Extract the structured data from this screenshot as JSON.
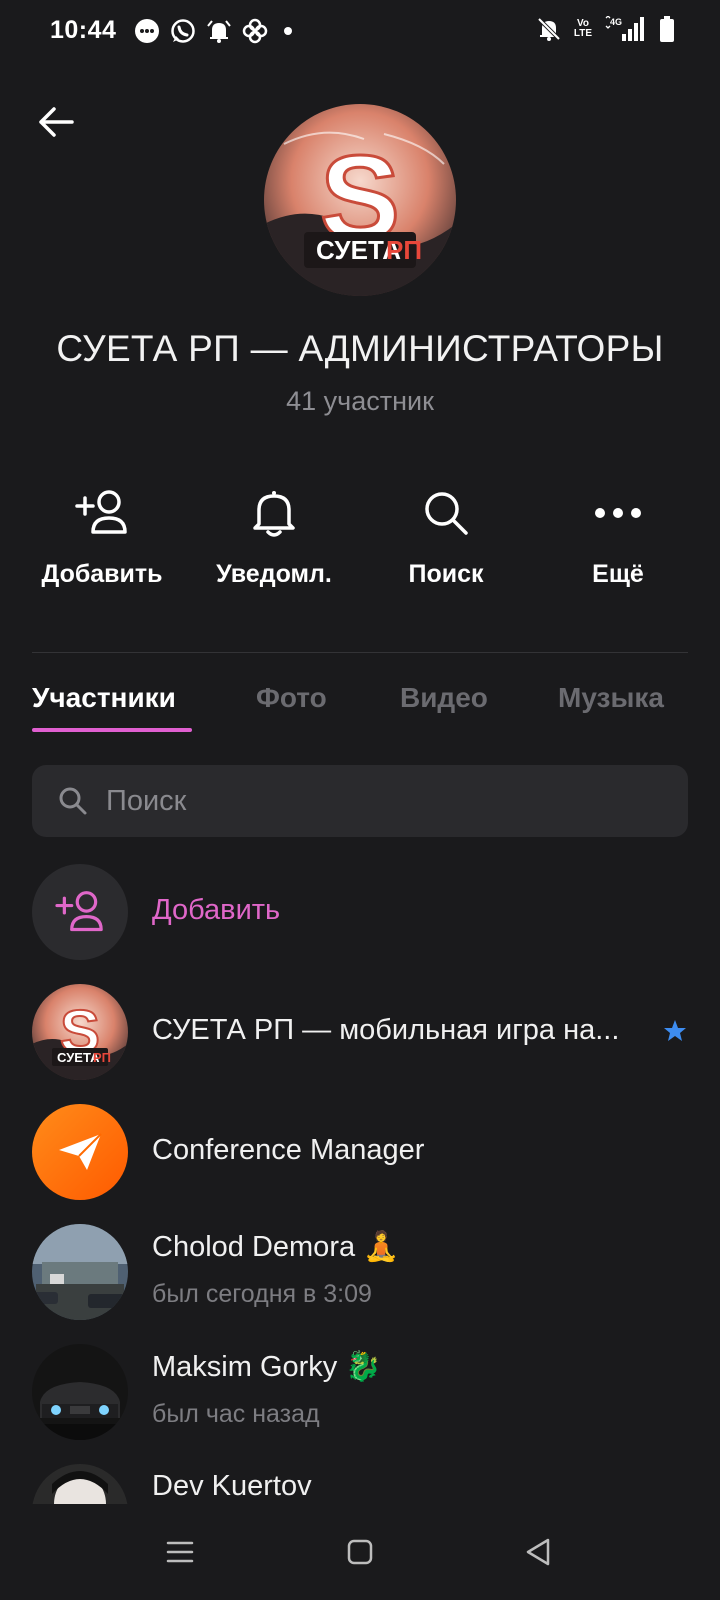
{
  "status_bar": {
    "time": "10:44",
    "left_icons": [
      "chat-bubble-icon",
      "whatsapp-icon",
      "alarm-icon",
      "pinwheel-icon"
    ],
    "right_icons": [
      "bell-off-icon",
      "volte-icon",
      "signal-4g-icon",
      "battery-icon"
    ],
    "volte_text": "Vo\nLTE",
    "network_label": "4G"
  },
  "header": {
    "group_title": "СУЕТА РП — АДМИНИСТРАТОРЫ",
    "members_count": "41 участник",
    "avatar_text_main": "СУЕТА",
    "avatar_text_accent": "РП",
    "avatar_letter": "S"
  },
  "actions": [
    {
      "label": "Добавить",
      "icon": "add-user-icon"
    },
    {
      "label": "Уведомл.",
      "icon": "bell-icon"
    },
    {
      "label": "Поиск",
      "icon": "search-icon"
    },
    {
      "label": "Ещё",
      "icon": "more-dots-icon"
    }
  ],
  "tabs": [
    {
      "label": "Участники",
      "active": true
    },
    {
      "label": "Фото",
      "active": false
    },
    {
      "label": "Видео",
      "active": false
    },
    {
      "label": "Музыка",
      "active": false
    }
  ],
  "search": {
    "placeholder": "Поиск"
  },
  "members": {
    "add_label": "Добавить",
    "items": [
      {
        "name": "СУЕТА РП — мобильная игра на...",
        "status": "",
        "badge": "star-icon"
      },
      {
        "name": "Conference Manager",
        "status": ""
      },
      {
        "name": "Cholod Demora 🧘",
        "status": "был сегодня в 3:09"
      },
      {
        "name": "Maksim Gorky 🐉",
        "status": "был час назад"
      },
      {
        "name": "Dev Kuertov",
        "status": ""
      }
    ]
  },
  "colors": {
    "background": "#1a1a1c",
    "accent": "#e05fd0",
    "star": "#3d8cf0",
    "conference_orange": "#ff6a00"
  }
}
